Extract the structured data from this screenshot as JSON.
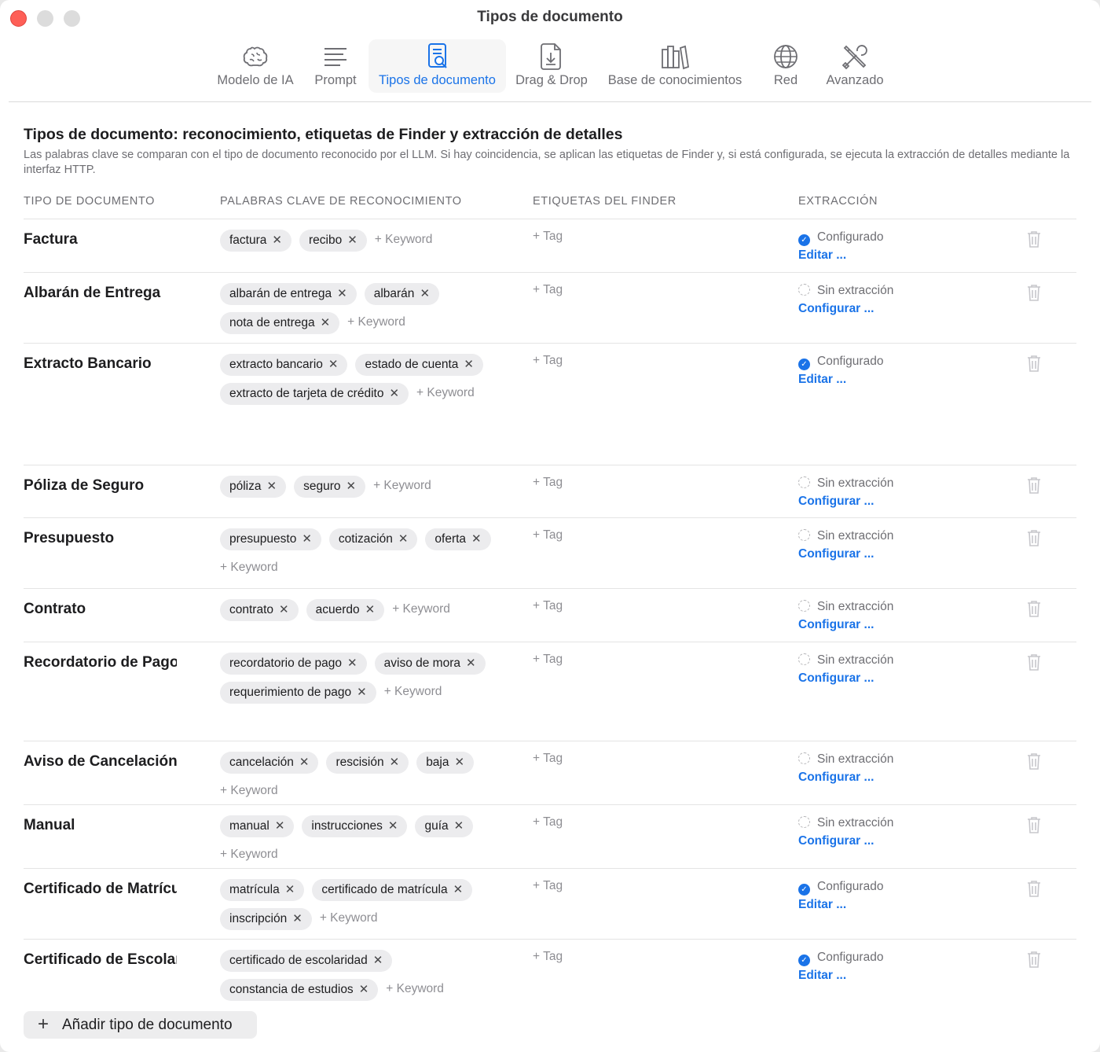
{
  "window": {
    "title": "Tipos de documento"
  },
  "toolbar": {
    "tabs": [
      {
        "label": "Modelo de IA",
        "icon": "brain-icon"
      },
      {
        "label": "Prompt",
        "icon": "text-lines-icon"
      },
      {
        "label": "Tipos de documento",
        "icon": "document-search-icon",
        "active": true
      },
      {
        "label": "Drag & Drop",
        "icon": "document-download-icon"
      },
      {
        "label": "Base de conocimientos",
        "icon": "books-icon"
      },
      {
        "label": "Red",
        "icon": "globe-icon"
      },
      {
        "label": "Avanzado",
        "icon": "tools-icon"
      }
    ]
  },
  "section": {
    "title": "Tipos de documento: reconocimiento, etiquetas de Finder y extracción de detalles",
    "description": "Las palabras clave se comparan con el tipo de documento reconocido por el LLM. Si hay coincidencia, se aplican las etiquetas de Finder y, si está configurada, se ejecuta la extracción de detalles mediante la interfaz HTTP."
  },
  "columns": {
    "type": "TIPO DE DOCUMENTO",
    "keywords": "PALABRAS CLAVE DE RECONOCIMIENTO",
    "tags": "ETIQUETAS DEL FINDER",
    "extraction": "EXTRACCIÓN"
  },
  "labels": {
    "add_keyword": "+ Keyword",
    "add_tag": "+ Tag",
    "configured": "Configurado",
    "not_configured": "Sin extracción",
    "edit": "Editar ...",
    "configure": "Configurar ...",
    "add_type": "Añadir tipo de documento"
  },
  "colors": {
    "accent": "#1a73e8",
    "close": "#fe5f57"
  },
  "rows": [
    {
      "name": "Factura",
      "keywords": [
        "factura",
        "recibo"
      ],
      "configured": true
    },
    {
      "name": "Albarán de Entrega",
      "keywords": [
        "albarán de entrega",
        "albarán",
        "nota de entrega"
      ],
      "configured": false
    },
    {
      "name": "Extracto Bancario",
      "keywords": [
        "extracto bancario",
        "estado de cuenta",
        "extracto de tarjeta de crédito"
      ],
      "configured": true
    },
    {
      "name": "Póliza de Seguro",
      "keywords": [
        "póliza",
        "seguro"
      ],
      "configured": false
    },
    {
      "name": "Presupuesto",
      "keywords": [
        "presupuesto",
        "cotización",
        "oferta"
      ],
      "configured": false
    },
    {
      "name": "Contrato",
      "keywords": [
        "contrato",
        "acuerdo"
      ],
      "configured": false
    },
    {
      "name": "Recordatorio de Pago",
      "keywords": [
        "recordatorio de pago",
        "aviso de mora",
        "requerimiento de pago"
      ],
      "configured": false
    },
    {
      "name": "Aviso de Cancelación",
      "keywords": [
        "cancelación",
        "rescisión",
        "baja"
      ],
      "configured": false
    },
    {
      "name": "Manual",
      "keywords": [
        "manual",
        "instrucciones",
        "guía"
      ],
      "configured": false
    },
    {
      "name": "Certificado de Matrícula",
      "keywords": [
        "matrícula",
        "certificado de matrícula",
        "inscripción"
      ],
      "configured": true
    },
    {
      "name": "Certificado de Escolaridad",
      "keywords": [
        "certificado de escolaridad",
        "constancia de estudios"
      ],
      "configured": true
    }
  ]
}
